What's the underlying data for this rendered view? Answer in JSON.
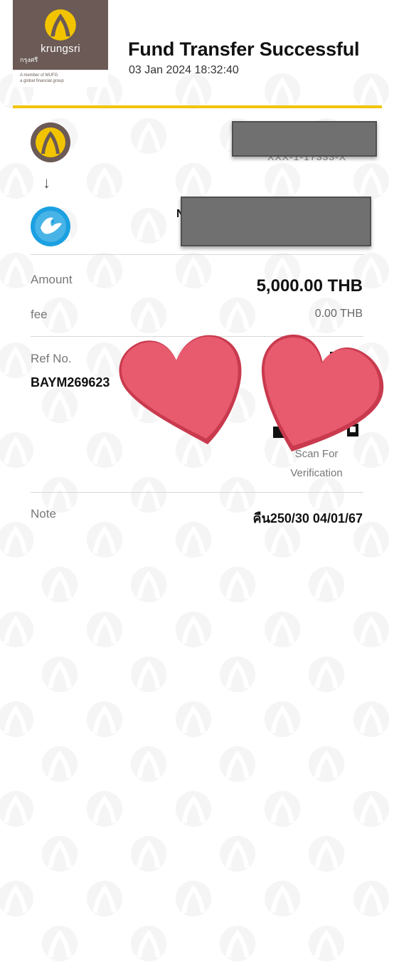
{
  "brand": {
    "name": "krungsri",
    "name_thai": "กรุงศรี",
    "tagline_1": "A member of MUFG",
    "tagline_2": "a global financial group",
    "color": "#6b5a55"
  },
  "header": {
    "title": "Fund Transfer Successful",
    "datetime": "03 Jan 2024 18:32:40"
  },
  "transfer": {
    "from_account_visible": "XXX-1-17333-X",
    "to_name_visible": "N",
    "arrow": "↓"
  },
  "details": {
    "amount_label": "Amount",
    "amount_value": "5,000.00 THB",
    "fee_label": "fee",
    "fee_value": "0.00 THB",
    "ref_label": "Ref No.",
    "ref_value": "BAYM269623",
    "scan_text_1": "Scan For",
    "scan_text_2": "Verification",
    "note_label": "Note",
    "note_value": "คืน250/30 04/01/67"
  },
  "colors": {
    "accent_line": "#f2c400",
    "to_bank_icon": "#1ba0e1",
    "heart": "#e85a6e",
    "redaction": "#707070"
  },
  "icons": {
    "from_bank": "krungsri-emblem-icon",
    "to_bank": "krungthai-bird-icon",
    "verification": "qr-code-icon",
    "overlay": "heart-sticker-icon"
  }
}
